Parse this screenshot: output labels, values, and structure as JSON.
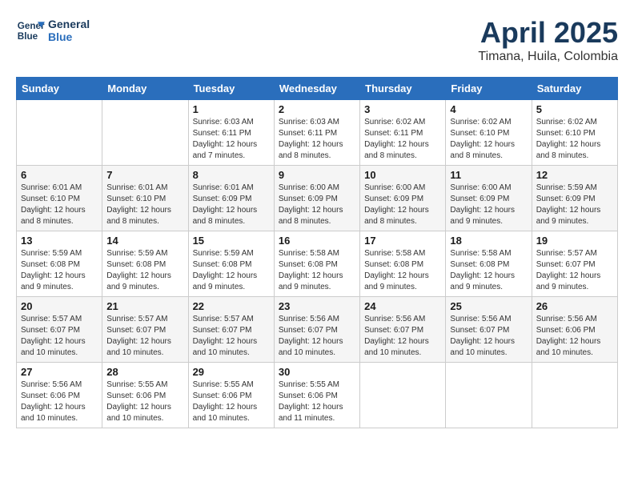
{
  "header": {
    "logo_line1": "General",
    "logo_line2": "Blue",
    "title": "April 2025",
    "subtitle": "Timana, Huila, Colombia"
  },
  "weekdays": [
    "Sunday",
    "Monday",
    "Tuesday",
    "Wednesday",
    "Thursday",
    "Friday",
    "Saturday"
  ],
  "weeks": [
    [
      {
        "day": "",
        "detail": ""
      },
      {
        "day": "",
        "detail": ""
      },
      {
        "day": "1",
        "detail": "Sunrise: 6:03 AM\nSunset: 6:11 PM\nDaylight: 12 hours\nand 7 minutes."
      },
      {
        "day": "2",
        "detail": "Sunrise: 6:03 AM\nSunset: 6:11 PM\nDaylight: 12 hours\nand 8 minutes."
      },
      {
        "day": "3",
        "detail": "Sunrise: 6:02 AM\nSunset: 6:11 PM\nDaylight: 12 hours\nand 8 minutes."
      },
      {
        "day": "4",
        "detail": "Sunrise: 6:02 AM\nSunset: 6:10 PM\nDaylight: 12 hours\nand 8 minutes."
      },
      {
        "day": "5",
        "detail": "Sunrise: 6:02 AM\nSunset: 6:10 PM\nDaylight: 12 hours\nand 8 minutes."
      }
    ],
    [
      {
        "day": "6",
        "detail": "Sunrise: 6:01 AM\nSunset: 6:10 PM\nDaylight: 12 hours\nand 8 minutes."
      },
      {
        "day": "7",
        "detail": "Sunrise: 6:01 AM\nSunset: 6:10 PM\nDaylight: 12 hours\nand 8 minutes."
      },
      {
        "day": "8",
        "detail": "Sunrise: 6:01 AM\nSunset: 6:09 PM\nDaylight: 12 hours\nand 8 minutes."
      },
      {
        "day": "9",
        "detail": "Sunrise: 6:00 AM\nSunset: 6:09 PM\nDaylight: 12 hours\nand 8 minutes."
      },
      {
        "day": "10",
        "detail": "Sunrise: 6:00 AM\nSunset: 6:09 PM\nDaylight: 12 hours\nand 8 minutes."
      },
      {
        "day": "11",
        "detail": "Sunrise: 6:00 AM\nSunset: 6:09 PM\nDaylight: 12 hours\nand 9 minutes."
      },
      {
        "day": "12",
        "detail": "Sunrise: 5:59 AM\nSunset: 6:09 PM\nDaylight: 12 hours\nand 9 minutes."
      }
    ],
    [
      {
        "day": "13",
        "detail": "Sunrise: 5:59 AM\nSunset: 6:08 PM\nDaylight: 12 hours\nand 9 minutes."
      },
      {
        "day": "14",
        "detail": "Sunrise: 5:59 AM\nSunset: 6:08 PM\nDaylight: 12 hours\nand 9 minutes."
      },
      {
        "day": "15",
        "detail": "Sunrise: 5:59 AM\nSunset: 6:08 PM\nDaylight: 12 hours\nand 9 minutes."
      },
      {
        "day": "16",
        "detail": "Sunrise: 5:58 AM\nSunset: 6:08 PM\nDaylight: 12 hours\nand 9 minutes."
      },
      {
        "day": "17",
        "detail": "Sunrise: 5:58 AM\nSunset: 6:08 PM\nDaylight: 12 hours\nand 9 minutes."
      },
      {
        "day": "18",
        "detail": "Sunrise: 5:58 AM\nSunset: 6:08 PM\nDaylight: 12 hours\nand 9 minutes."
      },
      {
        "day": "19",
        "detail": "Sunrise: 5:57 AM\nSunset: 6:07 PM\nDaylight: 12 hours\nand 9 minutes."
      }
    ],
    [
      {
        "day": "20",
        "detail": "Sunrise: 5:57 AM\nSunset: 6:07 PM\nDaylight: 12 hours\nand 10 minutes."
      },
      {
        "day": "21",
        "detail": "Sunrise: 5:57 AM\nSunset: 6:07 PM\nDaylight: 12 hours\nand 10 minutes."
      },
      {
        "day": "22",
        "detail": "Sunrise: 5:57 AM\nSunset: 6:07 PM\nDaylight: 12 hours\nand 10 minutes."
      },
      {
        "day": "23",
        "detail": "Sunrise: 5:56 AM\nSunset: 6:07 PM\nDaylight: 12 hours\nand 10 minutes."
      },
      {
        "day": "24",
        "detail": "Sunrise: 5:56 AM\nSunset: 6:07 PM\nDaylight: 12 hours\nand 10 minutes."
      },
      {
        "day": "25",
        "detail": "Sunrise: 5:56 AM\nSunset: 6:07 PM\nDaylight: 12 hours\nand 10 minutes."
      },
      {
        "day": "26",
        "detail": "Sunrise: 5:56 AM\nSunset: 6:06 PM\nDaylight: 12 hours\nand 10 minutes."
      }
    ],
    [
      {
        "day": "27",
        "detail": "Sunrise: 5:56 AM\nSunset: 6:06 PM\nDaylight: 12 hours\nand 10 minutes."
      },
      {
        "day": "28",
        "detail": "Sunrise: 5:55 AM\nSunset: 6:06 PM\nDaylight: 12 hours\nand 10 minutes."
      },
      {
        "day": "29",
        "detail": "Sunrise: 5:55 AM\nSunset: 6:06 PM\nDaylight: 12 hours\nand 10 minutes."
      },
      {
        "day": "30",
        "detail": "Sunrise: 5:55 AM\nSunset: 6:06 PM\nDaylight: 12 hours\nand 11 minutes."
      },
      {
        "day": "",
        "detail": ""
      },
      {
        "day": "",
        "detail": ""
      },
      {
        "day": "",
        "detail": ""
      }
    ]
  ]
}
